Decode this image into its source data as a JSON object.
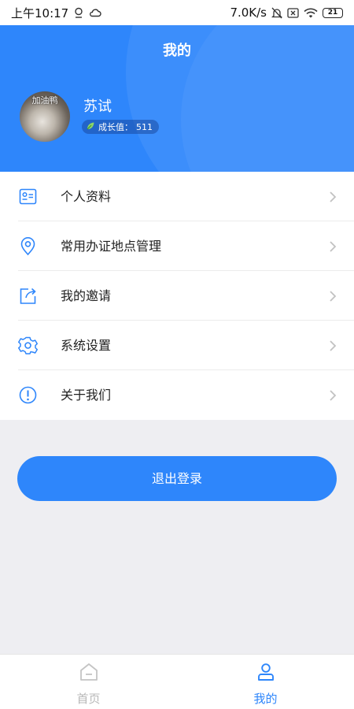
{
  "status_bar": {
    "time": "上午10:17",
    "network_speed": "7.0K/s",
    "battery": "21"
  },
  "header": {
    "title": "我的"
  },
  "profile": {
    "avatar_caption": "加油鸭",
    "name": "苏试",
    "growth_label": "成长值：",
    "growth_value": "511"
  },
  "menu": [
    {
      "label": "个人资料",
      "icon": "id-card-icon"
    },
    {
      "label": "常用办证地点管理",
      "icon": "location-pin-icon"
    },
    {
      "label": "我的邀请",
      "icon": "share-icon"
    },
    {
      "label": "系统设置",
      "icon": "gear-icon"
    },
    {
      "label": "关于我们",
      "icon": "info-circle-icon"
    }
  ],
  "logout": {
    "label": "退出登录"
  },
  "tabbar": {
    "tabs": [
      {
        "label": "首页",
        "icon": "home-icon",
        "active": false
      },
      {
        "label": "我的",
        "icon": "user-icon",
        "active": true
      }
    ],
    "active_color": "#2e86fb",
    "inactive_color": "#b8b8b8"
  },
  "colors": {
    "primary": "#2e86fb",
    "background": "#eeeef2"
  }
}
